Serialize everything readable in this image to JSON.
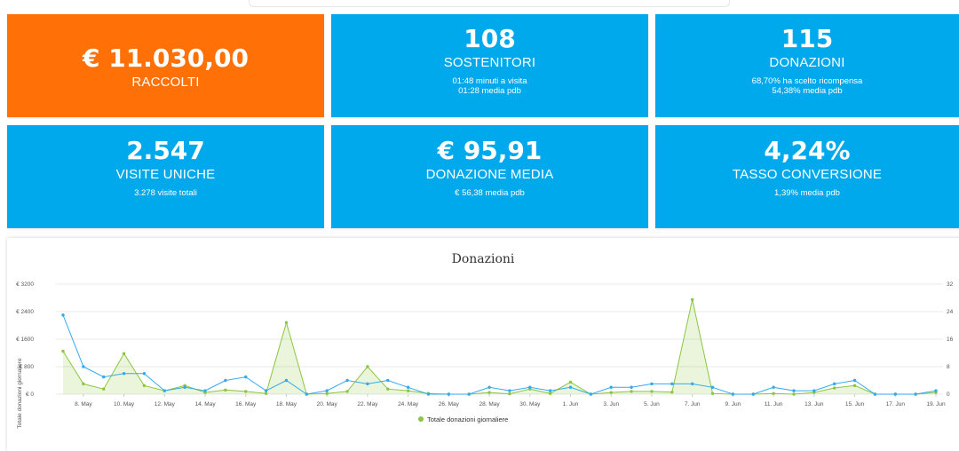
{
  "cards": [
    {
      "value": "€ 11.030,00",
      "label": "RACCOLTI",
      "subs": []
    },
    {
      "value": "108",
      "label": "SOSTENITORI",
      "subs": [
        "01:48 minuti a visita",
        "01:28 media pdb"
      ]
    },
    {
      "value": "115",
      "label": "DONAZIONI",
      "subs": [
        "68,70% ha scelto ricompensa",
        "54,38% media pdb"
      ]
    },
    {
      "value": "2.547",
      "label": "VISITE UNICHE",
      "subs": [
        "3.278 visite totali"
      ]
    },
    {
      "value": "€ 95,91",
      "label": "DONAZIONE MEDIA",
      "subs": [
        "€ 56,38 media pdb"
      ]
    },
    {
      "value": "4,24%",
      "label": "TASSO CONVERSIONE",
      "subs": [
        "1,39% media pdb"
      ]
    }
  ],
  "colors": {
    "orange": "#ff7107",
    "blue": "#00a8ec",
    "series_blue": "#33aaee",
    "series_green": "#8cc63e"
  },
  "chart_data": {
    "type": "line",
    "title": "Donazioni",
    "ylabel": "Totale donazioni giornaliere",
    "y_ticks": [
      "€ 0",
      "€ 800",
      "€ 1600",
      "€ 2400",
      "€ 3200"
    ],
    "y2_ticks": [
      "0",
      "8",
      "16",
      "24",
      "32"
    ],
    "ylim": [
      0,
      3200
    ],
    "y2lim": [
      0,
      32
    ],
    "x_labels": [
      "8. May",
      "10. May",
      "12. May",
      "14. May",
      "16. May",
      "18. May",
      "20. May",
      "22. May",
      "24. May",
      "26. May",
      "28. May",
      "30. May",
      "1. Jun",
      "3. Jun",
      "5. Jun",
      "7. Jun",
      "9. Jun",
      "11. Jun",
      "13. Jun",
      "15. Jun",
      "17. Jun",
      "19. Jun"
    ],
    "x_days": [
      "7. May",
      "8. May",
      "9. May",
      "10. May",
      "11. May",
      "12. May",
      "13. May",
      "14. May",
      "15. May",
      "16. May",
      "17. May",
      "18. May",
      "19. May",
      "20. May",
      "21. May",
      "22. May",
      "23. May",
      "24. May",
      "25. May",
      "26. May",
      "27. May",
      "28. May",
      "29. May",
      "30. May",
      "31. May",
      "1. Jun",
      "2. Jun",
      "3. Jun",
      "4. Jun",
      "5. Jun",
      "6. Jun",
      "7. Jun",
      "8. Jun",
      "9. Jun",
      "10. Jun",
      "11. Jun",
      "12. Jun",
      "13. Jun",
      "14. Jun",
      "15. Jun",
      "16. Jun",
      "17. Jun",
      "18. Jun",
      "19. Jun"
    ],
    "series": [
      {
        "name": "",
        "axis": "right",
        "color": "#33aaee",
        "values": [
          23,
          8,
          5,
          6,
          6,
          1,
          2,
          1,
          4,
          5,
          1,
          4,
          0,
          1,
          4,
          3,
          4,
          2,
          0,
          0,
          0,
          2,
          1,
          2,
          1,
          2,
          0,
          2,
          2,
          3,
          3,
          3,
          2,
          0,
          0,
          2,
          1,
          1,
          3,
          4,
          0,
          0,
          0,
          1
        ]
      },
      {
        "name": "",
        "axis": "left",
        "color": "#8cc63e",
        "values": [
          1250,
          300,
          150,
          1180,
          250,
          100,
          250,
          50,
          120,
          80,
          20,
          2080,
          0,
          20,
          80,
          800,
          150,
          100,
          20,
          0,
          0,
          50,
          10,
          150,
          20,
          350,
          0,
          50,
          80,
          80,
          60,
          2750,
          20,
          0,
          0,
          20,
          0,
          50,
          180,
          250,
          0,
          0,
          0,
          50
        ]
      }
    ],
    "legend_text": "Totale donazioni giornaliere",
    "legend_position": "bottom"
  }
}
